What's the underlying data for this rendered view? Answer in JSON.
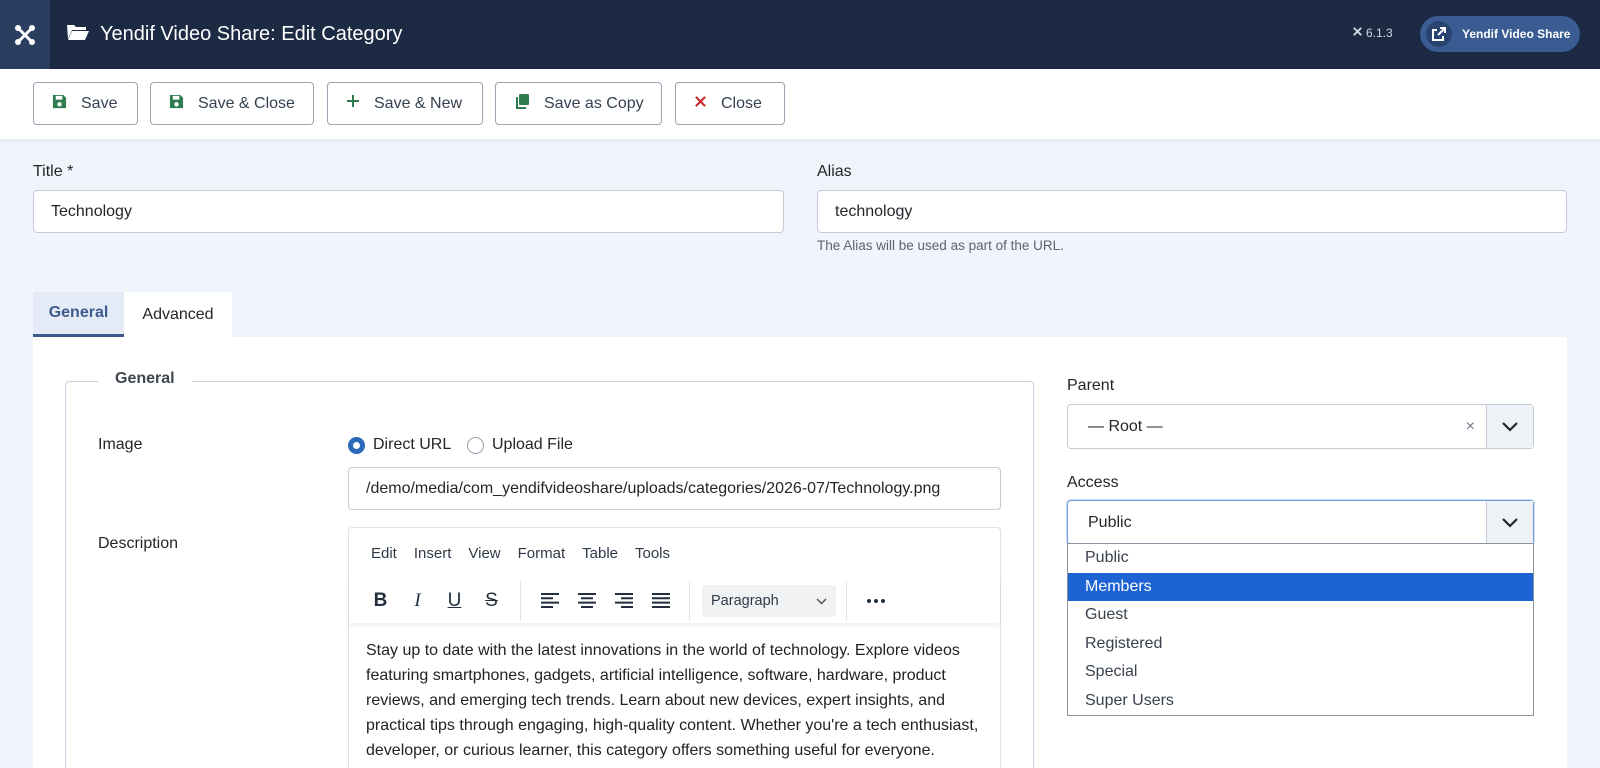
{
  "header": {
    "title": "Yendif Video Share: Edit Category",
    "version": "6.1.3",
    "site_button": "Yendif Video Share"
  },
  "toolbar": {
    "save": "Save",
    "save_close": "Save & Close",
    "save_new": "Save & New",
    "save_copy": "Save as Copy",
    "close": "Close"
  },
  "form": {
    "title_label": "Title *",
    "title_value": "Technology",
    "alias_label": "Alias",
    "alias_value": "technology",
    "alias_help": "The Alias will be used as part of the URL."
  },
  "tabs": {
    "general": "General",
    "advanced": "Advanced"
  },
  "general": {
    "legend": "General",
    "image_label": "Image",
    "radio_direct": "Direct URL",
    "radio_upload": "Upload File",
    "image_path": "/demo/media/com_yendifvideoshare/uploads/categories/2026-07/Technology.png",
    "description_label": "Description"
  },
  "editor": {
    "menu": [
      "Edit",
      "Insert",
      "View",
      "Format",
      "Table",
      "Tools"
    ],
    "block_format": "Paragraph",
    "content": "Stay up to date with the latest innovations in the world of technology. Explore videos featuring smartphones, gadgets, artificial intelligence, software, hardware, product reviews, and emerging tech trends. Learn about new devices, expert insights, and practical tips through engaging, high-quality content. Whether you're a tech enthusiast, developer, or curious learner, this category offers something useful for everyone."
  },
  "sidebar": {
    "parent_label": "Parent",
    "parent_value": "— Root —",
    "clear_symbol": "×",
    "access_label": "Access",
    "access_value": "Public",
    "access_options": [
      "Public",
      "Members",
      "Guest",
      "Registered",
      "Special",
      "Super Users"
    ],
    "highlighted_option": "Members"
  },
  "colors": {
    "header_bg": "#1c2a43",
    "accent": "#3d5a8e",
    "selected_option": "#1d63d4",
    "save_icon": "#2f7d4f",
    "close_icon": "#c52827"
  }
}
